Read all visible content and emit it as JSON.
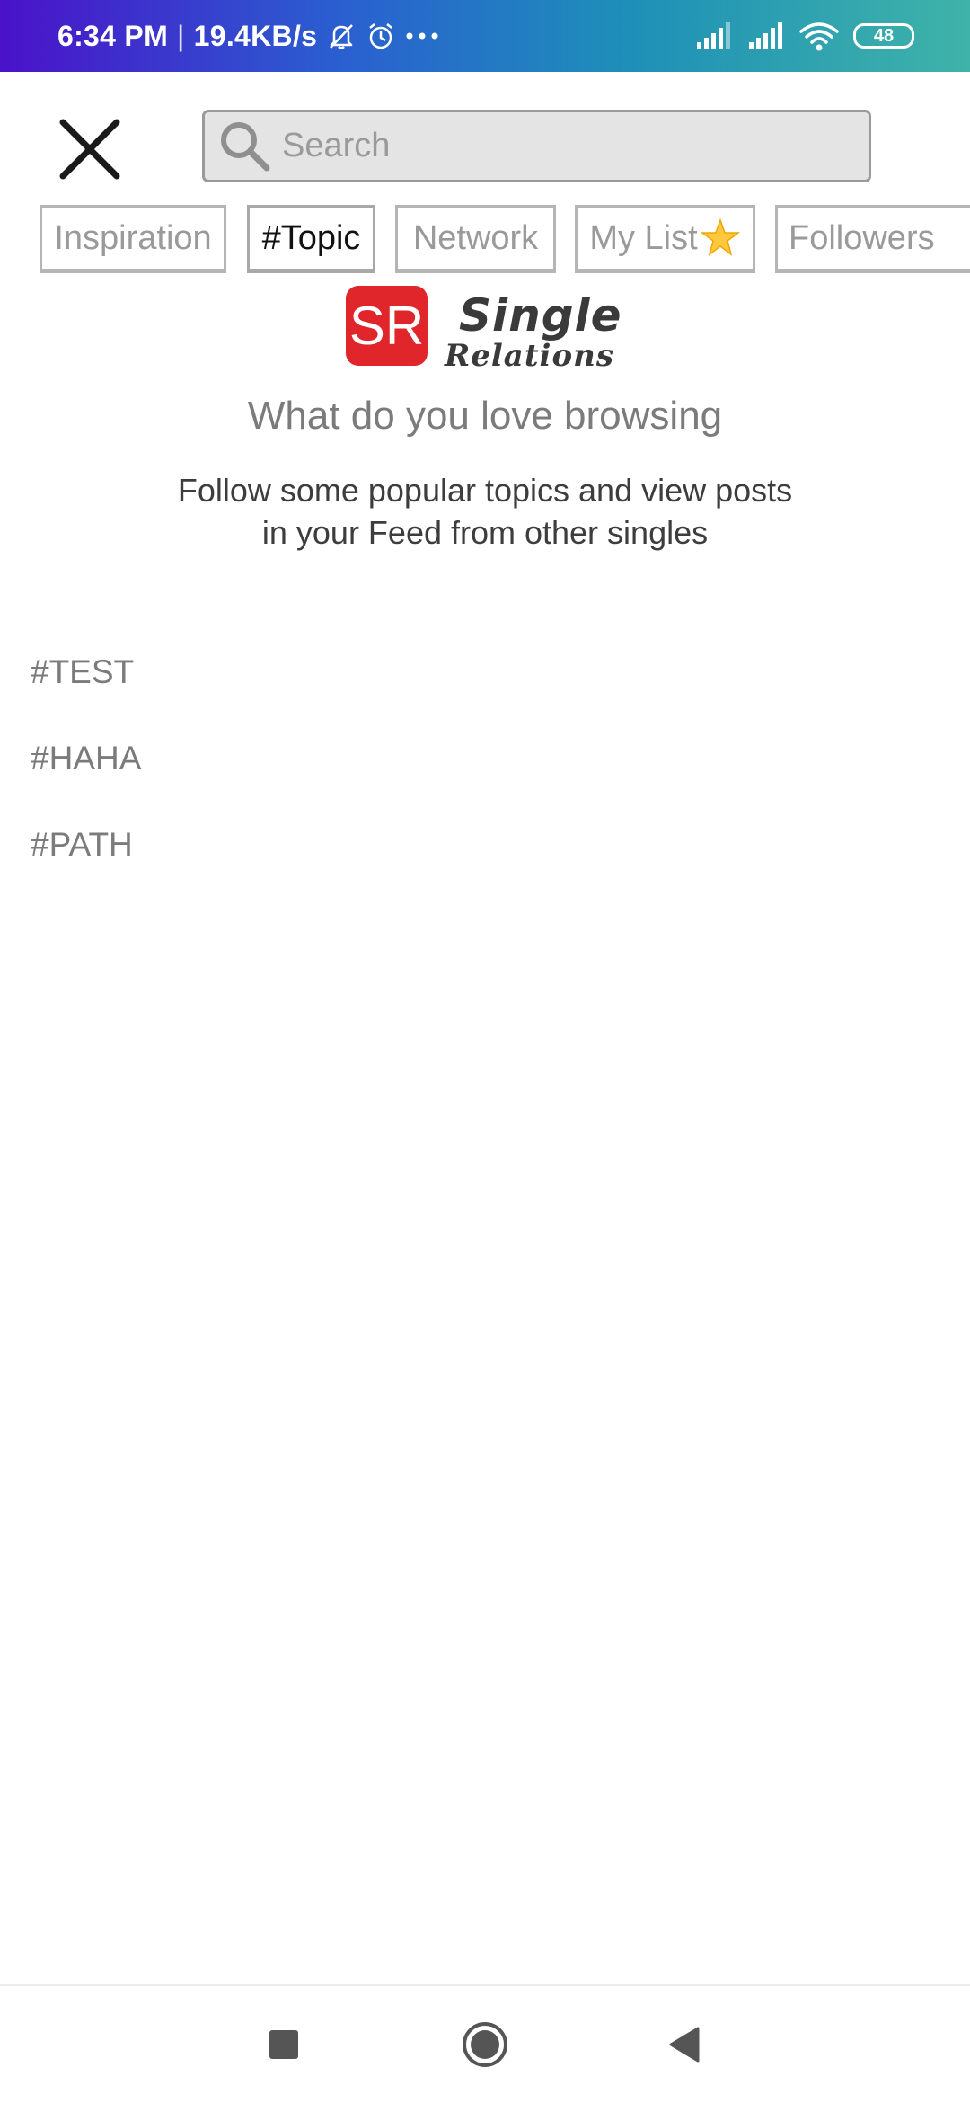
{
  "status_bar": {
    "time": "6:34 PM",
    "separator": "|",
    "net_speed": "19.4KB/s",
    "battery": "48",
    "icons": [
      "bell-mute-icon",
      "alarm-icon",
      "more-dots-icon",
      "signal-icon",
      "signal-icon",
      "wifi-icon",
      "battery-icon"
    ]
  },
  "header": {
    "close_icon": "close-icon",
    "search_placeholder": "Search",
    "search_value": ""
  },
  "tabs": [
    {
      "label": "Inspiration",
      "active": false
    },
    {
      "label": "#Topic",
      "active": true
    },
    {
      "label": "Network",
      "active": false
    },
    {
      "label": "My List",
      "active": false,
      "icon": "star-icon"
    },
    {
      "label": "Followers",
      "active": false
    }
  ],
  "logo": {
    "badge": "SR",
    "word1": "Single",
    "word2": "Relations",
    "badge_color": "#e0262b"
  },
  "intro": {
    "headline": "What do you love browsing",
    "line1": "Follow some popular topics and view posts",
    "line2": "in your Feed from other singles"
  },
  "topics": [
    "#TEST",
    "#HAHA",
    "#PATH"
  ],
  "nav_bar": {
    "buttons": [
      "recent-apps-icon",
      "home-icon",
      "back-icon"
    ]
  }
}
